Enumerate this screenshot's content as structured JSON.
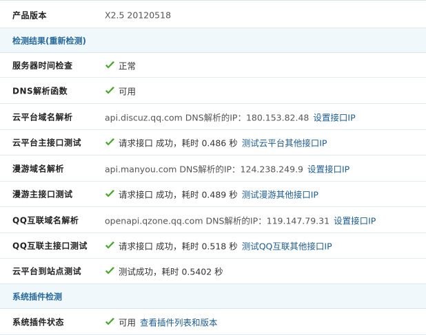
{
  "rows": [
    {
      "label": "产品版本",
      "value": "X2.5 20120518"
    },
    {
      "section": "检测结果(重新检测)"
    },
    {
      "label": "服务器时间检查",
      "value": "正常"
    },
    {
      "label": "DNS解析函数",
      "value": "可用"
    },
    {
      "label": "云平台域名解析",
      "value": "api.discuz.qq.com DNS解析的IP：180.153.82.48",
      "link": "设置接口IP"
    },
    {
      "label": "云平台主接口测试",
      "value": "请求接口 成功，耗时 0.486 秒",
      "link": "测试云平台其他接口IP"
    },
    {
      "label": "漫游域名解析",
      "value": "api.manyou.com DNS解析的IP：124.238.249.9",
      "link": "设置接口IP"
    },
    {
      "label": "漫游主接口测试",
      "value": "请求接口 成功，耗时 0.489 秒",
      "link": "测试漫游其他接口IP"
    },
    {
      "label": "QQ互联域名解析",
      "value": "openapi.qzone.qq.com DNS解析的IP：119.147.79.31",
      "link": "设置接口IP"
    },
    {
      "label": "QQ互联主接口测试",
      "value": "请求接口 成功，耗时 0.518 秒",
      "link": "测试QQ互联其他接口IP"
    },
    {
      "label": "云平台到站点测试",
      "value": "测试成功，耗时 0.5402 秒"
    },
    {
      "section": "系统插件检测"
    },
    {
      "label": "系统插件状态",
      "value": "可用",
      "link": "查看插件列表和版本"
    }
  ],
  "colors": {
    "section_bg": "#f1f8fc",
    "section_text": "#276a9b",
    "link": "#1c5b91",
    "check_green": "#4aa52f",
    "divider": "#dfeaf1"
  },
  "icons": {
    "check": "check-icon"
  }
}
